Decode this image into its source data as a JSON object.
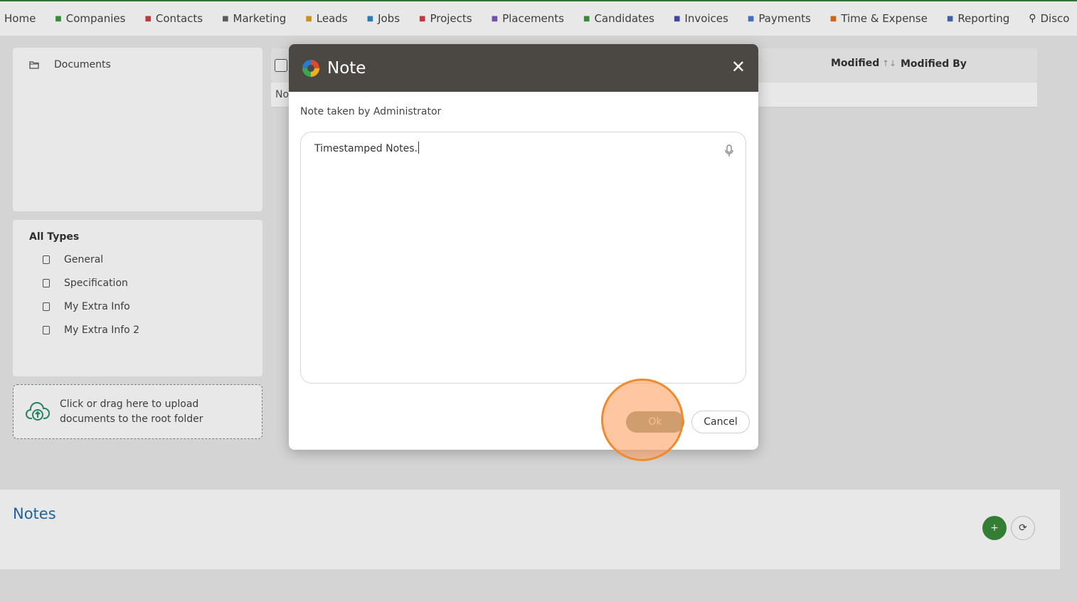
{
  "topnav": {
    "items": [
      {
        "label": "Home",
        "icon": "home-icon",
        "color": "#444444"
      },
      {
        "label": "Companies",
        "icon": "building-icon",
        "color": "#3a9a3a"
      },
      {
        "label": "Contacts",
        "icon": "contact-card-icon",
        "color": "#d04040"
      },
      {
        "label": "Marketing",
        "icon": "broadcast-icon",
        "color": "#666666"
      },
      {
        "label": "Leads",
        "icon": "diamond-icon",
        "color": "#e0a020"
      },
      {
        "label": "Jobs",
        "icon": "trophy-icon",
        "color": "#2a8ad0"
      },
      {
        "label": "Projects",
        "icon": "checkbox-icon",
        "color": "#d04040"
      },
      {
        "label": "Placements",
        "icon": "briefcase-icon",
        "color": "#7a5ac0"
      },
      {
        "label": "Candidates",
        "icon": "person-icon",
        "color": "#3a9a3a"
      },
      {
        "label": "Invoices",
        "icon": "invoice-icon",
        "color": "#4a4ab0"
      },
      {
        "label": "Payments",
        "icon": "coins-icon",
        "color": "#4a7ad0"
      },
      {
        "label": "Time & Expense",
        "icon": "clock-icon",
        "color": "#e07020"
      },
      {
        "label": "Reporting",
        "icon": "bar-chart-icon",
        "color": "#4a6ab0"
      },
      {
        "label": "Disco",
        "icon": "search-icon",
        "color": "#333333"
      }
    ]
  },
  "documents": {
    "folder_label": "Documents",
    "types_title": "All Types",
    "types": [
      "General",
      "Specification",
      "My Extra Info",
      "My Extra Info 2"
    ],
    "upload_text_line1": "Click or drag here to upload",
    "upload_text_line2": "documents to the root folder"
  },
  "grid": {
    "col_modified": "Modified",
    "col_modified_by": "Modified By",
    "row_partial": "No"
  },
  "notes": {
    "title": "Notes",
    "add_glyph": "+",
    "refresh_glyph": "⟳"
  },
  "modal": {
    "title": "Note",
    "close_glyph": "✕",
    "note_by": "Note taken by Administrator",
    "note_text": "Timestamped Notes.",
    "ok_label": "Ok",
    "cancel_label": "Cancel"
  },
  "colors": {
    "accent_green": "#3a7d3a",
    "modal_header": "#4b4843",
    "notes_title": "#1f6fa8",
    "click_highlight": "#f08a2c"
  }
}
